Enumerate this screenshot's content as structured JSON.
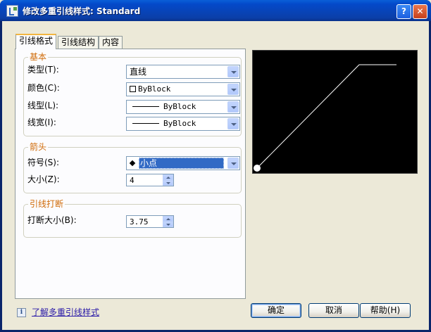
{
  "window": {
    "title": "修改多重引线样式: Standard",
    "help_btn": "?",
    "close_btn": "✕"
  },
  "tabs": [
    {
      "label": "引线格式",
      "active": true
    },
    {
      "label": "引线结构",
      "active": false
    },
    {
      "label": "内容",
      "active": false
    }
  ],
  "basic": {
    "title": "基本",
    "type_label": "类型(T):",
    "type_value": "直线",
    "color_label": "颜色(C):",
    "color_value": "ByBlock",
    "linetype_label": "线型(L):",
    "linetype_value": "ByBlock",
    "lineweight_label": "线宽(I):",
    "lineweight_value": "ByBlock"
  },
  "arrow": {
    "title": "箭头",
    "symbol_label": "符号(S):",
    "symbol_value": "小点",
    "size_label": "大小(Z):",
    "size_value": "4"
  },
  "break": {
    "title": "引线打断",
    "size_label": "打断大小(B):",
    "size_value": "3.75"
  },
  "footer": {
    "info_icon": "i",
    "help_link": "了解多重引线样式",
    "ok": "确定",
    "cancel": "取消",
    "help": "帮助(H)"
  },
  "colors": {
    "title_bar": "#0b4fc9",
    "group_title": "#d06c0a",
    "preview_bg": "#000000",
    "selection": "#316ac5"
  }
}
